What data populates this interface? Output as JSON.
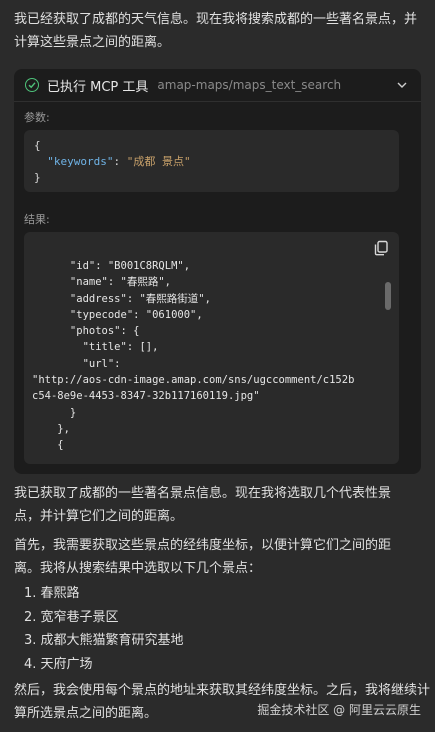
{
  "intro": "我已经获取了成都的天气信息。现在我将搜索成都的一些著名景点，并计算这些景点之间的距离。",
  "tool_card": {
    "title": "已执行 MCP 工具",
    "tool_name": "amap-maps/maps_text_search",
    "params_label": "参数:",
    "params_lines": [
      {
        "pre": "{",
        "key": "",
        "sep": "",
        "val": ""
      },
      {
        "pre": "  ",
        "key": "\"keywords\"",
        "sep": ": ",
        "val": "\"成都 景点\""
      },
      {
        "pre": "}",
        "key": "",
        "sep": "",
        "val": ""
      }
    ],
    "result_label": "结果:",
    "result_lines": [
      "      \"id\": \"B001C8RQLM\",",
      "      \"name\": \"春熙路\",",
      "      \"address\": \"春熙路街道\",",
      "      \"typecode\": \"061000\",",
      "      \"photos\": {",
      "        \"title\": [],",
      "        \"url\":",
      "\"http://aos-cdn-image.amap.com/sns/ugccomment/c152b",
      "c54-8e9e-4453-8347-32b117160119.jpg\"",
      "      }",
      "    },",
      "    {"
    ]
  },
  "para1": "我已获取了成都的一些著名景点信息。现在我将选取几个代表性景点，并计算它们之间的距离。",
  "para2": "首先，我需要获取这些景点的经纬度坐标，以便计算它们之间的距离。我将从搜索结果中选取以下几个景点：",
  "list": [
    "1. 春熙路",
    "2. 宽窄巷子景区",
    "3. 成都大熊猫繁育研究基地",
    "4. 天府广场"
  ],
  "outro": "然后，我会使用每个景点的地址来获取其经纬度坐标。之后，我将继续计算所选景点之间的距离。",
  "watermark": "掘金技术社区 @ 阿里云云原生",
  "colors": {
    "background": "#2b2b2b",
    "card": "#1c1c1c",
    "check": "#4ec27a",
    "key": "#6fb3e6",
    "string": "#c7a06a"
  }
}
